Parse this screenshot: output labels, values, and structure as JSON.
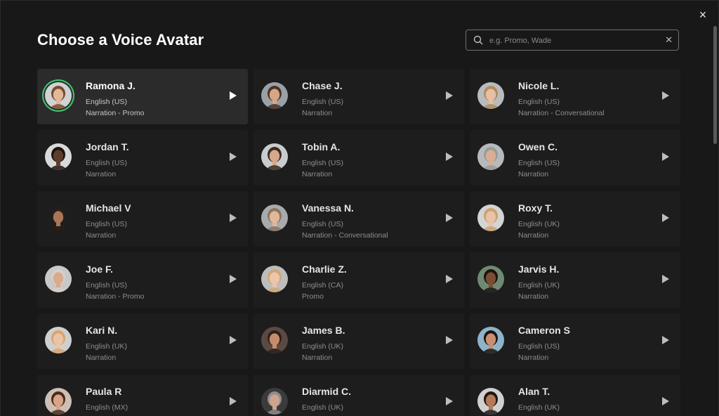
{
  "dialog": {
    "title": "Choose a Voice Avatar",
    "close_label": "×"
  },
  "search": {
    "placeholder": "e.g. Promo, Wade",
    "value": "",
    "clear_label": "✕"
  },
  "colors": {
    "selected_ring": "#3fc56a",
    "card_bg": "#1d1d1d",
    "selected_bg": "#2b2b2b"
  },
  "voices": [
    {
      "name": "Ramona J.",
      "language": "English (US)",
      "category": "Narration - Promo",
      "selected": true,
      "skin": "#e2b79a",
      "hair": "#7a4a2c",
      "bg": "#cfd3d6"
    },
    {
      "name": "Chase J.",
      "language": "English (US)",
      "category": "Narration",
      "skin": "#d7a688",
      "hair": "#4b3324",
      "bg": "#9aa1a6"
    },
    {
      "name": "Nicole L.",
      "language": "English (US)",
      "category": "Narration - Conversational",
      "skin": "#e6bfa4",
      "hair": "#b38b5b",
      "bg": "#b9bcbf"
    },
    {
      "name": "Jordan T.",
      "language": "English (US)",
      "category": "Narration",
      "skin": "#5e3d2c",
      "hair": "#1c1410",
      "bg": "#d9d9d9"
    },
    {
      "name": "Tobin A.",
      "language": "English (US)",
      "category": "Narration",
      "skin": "#d6a98c",
      "hair": "#3a2a1f",
      "bg": "#c9cccf"
    },
    {
      "name": "Owen C.",
      "language": "English (US)",
      "category": "Narration",
      "skin": "#d9ae94",
      "hair": "#9b9b9b",
      "bg": "#b7babd"
    },
    {
      "name": "Michael V",
      "language": "English (US)",
      "category": "Narration",
      "skin": "#a87658",
      "hair": "#2a1d16",
      "bg": "#1e1e1e"
    },
    {
      "name": "Vanessa N.",
      "language": "English (US)",
      "category": "Narration - Conversational",
      "skin": "#e2b89c",
      "hair": "#8a7560",
      "bg": "#a8abad"
    },
    {
      "name": "Roxy T.",
      "language": "English (UK)",
      "category": "Narration",
      "skin": "#e9c3a7",
      "hair": "#c9a26f",
      "bg": "#d4d4d4"
    },
    {
      "name": "Joe F.",
      "language": "English (US)",
      "category": "Narration - Promo",
      "skin": "#dba98c",
      "hair": "#d7cfc6",
      "bg": "#c8c8c8"
    },
    {
      "name": "Charlie Z.",
      "language": "English (CA)",
      "category": "Promo",
      "skin": "#ebc6aa",
      "hair": "#cfa878",
      "bg": "#bdbdbd"
    },
    {
      "name": "Jarvis H.",
      "language": "English (UK)",
      "category": "Narration",
      "skin": "#7a4d34",
      "hair": "#1b1310",
      "bg": "#6f8a73"
    },
    {
      "name": "Kari N.",
      "language": "English (UK)",
      "category": "Narration",
      "skin": "#ebc4a6",
      "hair": "#d9a56a",
      "bg": "#cfcfcf"
    },
    {
      "name": "James B.",
      "language": "English (UK)",
      "category": "Narration",
      "skin": "#c58d6c",
      "hair": "#2e211a",
      "bg": "#5b4a44"
    },
    {
      "name": "Cameron S",
      "language": "English (US)",
      "category": "Narration",
      "skin": "#c99070",
      "hair": "#1b1412",
      "bg": "#8fb3c9"
    },
    {
      "name": "Paula R",
      "language": "English (MX)",
      "category": "",
      "skin": "#d9a488",
      "hair": "#4a2c1d",
      "bg": "#cdbfb4"
    },
    {
      "name": "Diarmid C.",
      "language": "English (UK)",
      "category": "",
      "skin": "#cfa48c",
      "hair": "#8e8e8e",
      "bg": "#3b3b3b"
    },
    {
      "name": "Alan T.",
      "language": "English (UK)",
      "category": "",
      "skin": "#b57a58",
      "hair": "#1f1612",
      "bg": "#d0d0d0"
    }
  ]
}
